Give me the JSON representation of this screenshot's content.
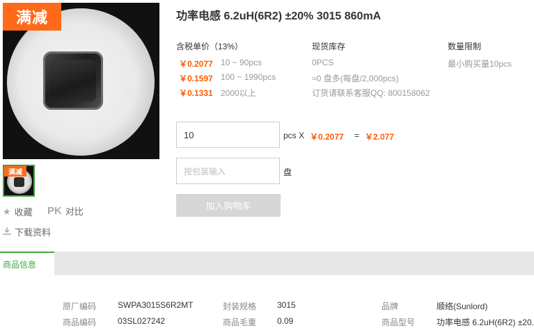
{
  "gallery": {
    "promo_label": "满减",
    "thumb_label": "满减",
    "favorite_label": "收藏",
    "pk_label": "PK",
    "compare_label": "对比",
    "download_label": "下载资料"
  },
  "product": {
    "title": "功率电感 6.2uH(6R2) ±20% 3015 860mA"
  },
  "pricing": {
    "header": "含税单价（13%）",
    "tiers": [
      {
        "price": "￥0.2077",
        "range": "10 ~ 90pcs"
      },
      {
        "price": "￥0.1597",
        "range": "100 ~ 1990pcs"
      },
      {
        "price": "￥0.1331",
        "range": "2000以上"
      }
    ]
  },
  "stock": {
    "header": "现货库存",
    "lines": [
      "0PCS",
      "≈0 盘多(每盘/2,000pcs)",
      "订货请联系客服QQ: 800158062"
    ]
  },
  "limit": {
    "header": "数量限制",
    "text": "最小购买量10pcs"
  },
  "order": {
    "qty_value": "10",
    "qty_unit": "pcs X",
    "unit_price": "￥0.2077",
    "equals": "=",
    "total": "￥2.077",
    "pack_placeholder": "按包装输入",
    "pack_unit": "盘",
    "cart_button": "加入购物车"
  },
  "tabs": {
    "active": "商品信息"
  },
  "specs": {
    "rows": [
      [
        {
          "label": "原厂编码",
          "value": "SWPA3015S6R2MT"
        },
        {
          "label": "封装规格",
          "value": "3015"
        },
        {
          "label": "品牌",
          "value": "顺络(Sunlord)"
        }
      ],
      [
        {
          "label": "商品编码",
          "value": "03SL027242"
        },
        {
          "label": "商品毛重",
          "value": "0.09"
        },
        {
          "label": "商品型号",
          "value": "功率电感 6.2uH(6R2) ±20."
        }
      ]
    ]
  },
  "colors": {
    "accent_orange": "#ff6a1a",
    "price_orange": "#ff5a00",
    "tab_green": "#3aa63a"
  }
}
